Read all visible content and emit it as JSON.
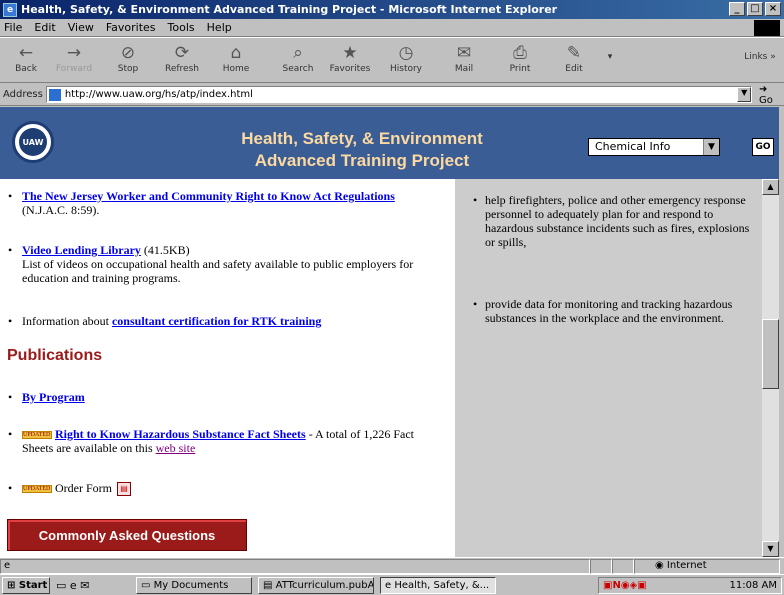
{
  "window": {
    "title": "Health, Safety, & Environment Advanced Training Project - Microsoft Internet Explorer"
  },
  "menu": [
    "File",
    "Edit",
    "View",
    "Favorites",
    "Tools",
    "Help"
  ],
  "toolbar": {
    "buttons": [
      {
        "label": "Back",
        "icon": "back-arrow-icon"
      },
      {
        "label": "Forward",
        "icon": "forward-arrow-icon"
      },
      {
        "label": "Stop",
        "icon": "stop-icon"
      },
      {
        "label": "Refresh",
        "icon": "refresh-icon"
      },
      {
        "label": "Home",
        "icon": "home-icon"
      },
      {
        "label": "Search",
        "icon": "search-icon"
      },
      {
        "label": "Favorites",
        "icon": "favorites-icon"
      },
      {
        "label": "History",
        "icon": "history-icon"
      },
      {
        "label": "Mail",
        "icon": "mail-icon"
      },
      {
        "label": "Print",
        "icon": "print-icon"
      },
      {
        "label": "Edit",
        "icon": "edit-icon"
      }
    ],
    "links_label": "Links"
  },
  "address": {
    "label": "Address",
    "url": "http://www.uaw.org/hs/atp/index.html",
    "go_label": "Go"
  },
  "banner": {
    "logo_text": "UAW",
    "title_line1": "Health, Safety, & Environment",
    "title_line2": "Advanced Training Project",
    "select_value": "Chemical Info",
    "go_label": "GO"
  },
  "left": {
    "items": [
      {
        "link": "The New Jersey Worker and Community Right to Know Act Regulations",
        "suffix": " (N.J.A.C. 8:59)."
      },
      {
        "link": "Video Lending Library",
        "suffix": " (41.5KB)",
        "desc": "List of videos on occupational health and safety available to public employers for education and training programs."
      },
      {
        "prefix": "Information about ",
        "link": "consultant certification for RTK training"
      }
    ],
    "publications_heading": "Publications",
    "pub_items": [
      {
        "link": "By Program"
      },
      {
        "badge": "UPDATED",
        "link": "Right to Know Hazardous Substance Fact Sheets",
        "suffix": " - A total of 1,226 Fact Sheets are available on this ",
        "link2": "web site"
      },
      {
        "badge": "UPDATED",
        "text": "Order Form"
      }
    ],
    "faq_button": "Commonly Asked Questions"
  },
  "right": {
    "items": [
      "help firefighters, police and other emergency response personnel to adequately plan for and respond to hazardous substance incidents such as fires, explosions or spills,",
      "provide data for monitoring and tracking hazardous substances in the workplace and the environment."
    ]
  },
  "status": {
    "zone": "Internet"
  },
  "taskbar": {
    "start": "Start",
    "tasks": [
      "My Documents",
      "ATTcurriculum.pubA...",
      "Health, Safety, &..."
    ],
    "clock": "11:08 AM"
  }
}
